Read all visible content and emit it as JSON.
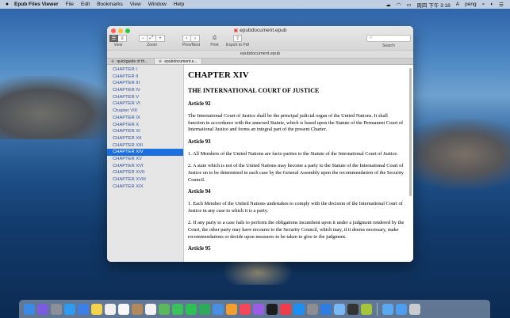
{
  "menubar": {
    "app_name": "Epub Files Viewer",
    "menus": [
      "File",
      "Edit",
      "Bookmarks",
      "View",
      "Window",
      "Help"
    ],
    "clock": "周四 下午 3:18",
    "user": "peng"
  },
  "window": {
    "title": "epubdocument.epub",
    "path": "epubdocument.epub",
    "toolbar": {
      "view_label": "View",
      "zoom_label": "Zoom",
      "prevnext_label": "Prev/Next",
      "print_label": "Print",
      "export_label": "Export to Pdf",
      "search_label": "Search",
      "search_placeholder": "Search"
    },
    "tabs": [
      {
        "label": "quickguide of th...",
        "active": false
      },
      {
        "label": "epubdocument.e...",
        "active": true
      }
    ]
  },
  "sidebar": {
    "items": [
      {
        "label": "CHAPTER I",
        "selected": false
      },
      {
        "label": "CHAPTER II",
        "selected": false
      },
      {
        "label": "CHAPTER III",
        "selected": false
      },
      {
        "label": "CHAPTER IV",
        "selected": false
      },
      {
        "label": "CHAPTER V",
        "selected": false
      },
      {
        "label": "CHAPTER VI",
        "selected": false
      },
      {
        "label": "Chapter VIII",
        "selected": false
      },
      {
        "label": "CHAPTER IX",
        "selected": false
      },
      {
        "label": "CHAPTER X",
        "selected": false
      },
      {
        "label": "CHAPTER XI",
        "selected": false
      },
      {
        "label": "CHAPTER XII",
        "selected": false
      },
      {
        "label": "CHAPTER XIII",
        "selected": false
      },
      {
        "label": "CHAPTER XIV",
        "selected": true
      },
      {
        "label": "CHAPTER XV",
        "selected": false
      },
      {
        "label": "CHAPTER XVI",
        "selected": false
      },
      {
        "label": "CHAPTER XVII",
        "selected": false
      },
      {
        "label": "CHAPTER XVIII",
        "selected": false
      },
      {
        "label": "CHAPTER XIX",
        "selected": false
      }
    ]
  },
  "content": {
    "chapter": "CHAPTER XIV",
    "heading": "THE INTERNATIONAL COURT OF JUSTICE",
    "art92": "Article 92",
    "p92": "The International Court of Justice shall be the principal judicial organ of the United Nations. It shall function in accordance with the annexed Statute, which is based upon the Statute of the Permanent Court of International Justice and forms an integral part of the present Charter.",
    "art93": "Article 93",
    "p93a": "1. All Members of the United Nations are facto parties to the Statute of the International Court of Justice.",
    "p93b": "2. A state which is not of the United Nations may become a party to the Statute of the International Court of Justice on to be determined in each case by the General Assembly upon the recommendation of the Security Council.",
    "art94": "Article 94",
    "p94a": "1. Each Member of the United Nations undertakes to comply with the decision of the International Court of Justice in any case to which it is a party.",
    "p94b": "2. If any party to a case fails to perform the obligations incumbent upon it under a judgment rendered by the Court, the other party may have recourse to the Security Council, which may, if it deems necessary, make recommendations or decide upon measures to be taken to give to the judgment.",
    "art95": "Article 95"
  },
  "dock": {
    "icons": [
      "finder-icon",
      "siri-icon",
      "launchpad-icon",
      "safari-icon",
      "mail-icon",
      "notes-icon",
      "calendar-icon",
      "reminders-icon",
      "contacts-icon",
      "photos-icon",
      "maps-icon",
      "messages-icon",
      "facetime-icon",
      "numbers-icon",
      "keynote-icon",
      "pages-icon",
      "music-icon",
      "podcasts-icon",
      "tv-icon",
      "news-icon",
      "app-store-icon",
      "system-preferences-icon",
      "xcode-icon",
      "preview-icon",
      "terminal-icon",
      "android-icon",
      "folder-icon",
      "downloads-icon",
      "trash-icon"
    ]
  }
}
